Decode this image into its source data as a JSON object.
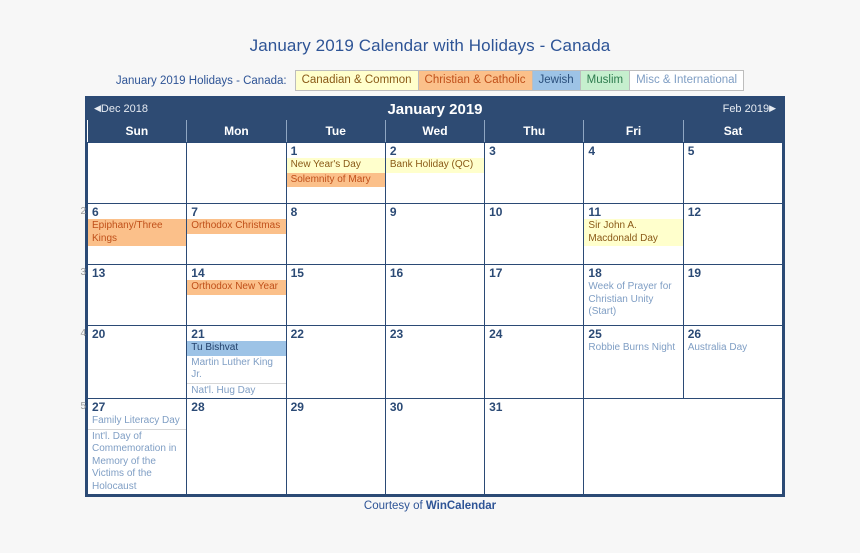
{
  "title": "January 2019 Calendar with Holidays - Canada",
  "legend": {
    "label": "January 2019 Holidays - Canada:",
    "chips": [
      {
        "text": "Canadian & Common",
        "key": "canadian",
        "bg": "#ffffcc",
        "fg": "#8a5a17"
      },
      {
        "text": "Christian & Catholic",
        "key": "christian",
        "bg": "#fbc08a",
        "fg": "#c0501a"
      },
      {
        "text": "Jewish",
        "key": "jewish",
        "bg": "#9dc3e6",
        "fg": "#2a4f7c"
      },
      {
        "text": "Muslim",
        "key": "muslim",
        "bg": "#c6efce",
        "fg": "#2e7d4f"
      },
      {
        "text": "Misc & International",
        "key": "misc",
        "bg": "#ffffff",
        "fg": "#7f9ec4"
      }
    ]
  },
  "nav": {
    "prev": "Dec 2018",
    "prev_arrow": "◀",
    "title": "January 2019",
    "next": "Feb 2019",
    "next_arrow": "▶"
  },
  "weekdays": [
    "Sun",
    "Mon",
    "Tue",
    "Wed",
    "Thu",
    "Fri",
    "Sat"
  ],
  "week_numbers": [
    "",
    "2",
    "3",
    "4",
    "5"
  ],
  "watermark": "WinCalendar",
  "footer": {
    "prefix": "Courtesy of ",
    "brand": "WinCalendar"
  },
  "weeks": [
    {
      "num": "",
      "days": [
        {
          "day": "",
          "blank": true,
          "events": []
        },
        {
          "day": "",
          "blank": true,
          "events": []
        },
        {
          "day": "1",
          "events": [
            {
              "text": "New Year's Day",
              "type": "canadian"
            },
            {
              "text": "Solemnity of Mary",
              "type": "christian"
            }
          ]
        },
        {
          "day": "2",
          "events": [
            {
              "text": "Bank Holiday (QC)",
              "type": "canadian"
            }
          ]
        },
        {
          "day": "3",
          "events": []
        },
        {
          "day": "4",
          "events": []
        },
        {
          "day": "5",
          "weekend": true,
          "events": []
        }
      ]
    },
    {
      "num": "2",
      "days": [
        {
          "day": "6",
          "weekend": true,
          "events": [
            {
              "text": "Epiphany/Three Kings",
              "type": "christian"
            }
          ]
        },
        {
          "day": "7",
          "events": [
            {
              "text": "Orthodox Christmas",
              "type": "christian"
            }
          ]
        },
        {
          "day": "8",
          "events": []
        },
        {
          "day": "9",
          "events": []
        },
        {
          "day": "10",
          "events": []
        },
        {
          "day": "11",
          "events": [
            {
              "text": "Sir John A. Macdonald Day",
              "type": "canadian"
            }
          ]
        },
        {
          "day": "12",
          "weekend": true,
          "events": []
        }
      ]
    },
    {
      "num": "3",
      "days": [
        {
          "day": "13",
          "weekend": true,
          "events": []
        },
        {
          "day": "14",
          "events": [
            {
              "text": "Orthodox New Year",
              "type": "christian"
            }
          ]
        },
        {
          "day": "15",
          "events": []
        },
        {
          "day": "16",
          "events": []
        },
        {
          "day": "17",
          "events": []
        },
        {
          "day": "18",
          "events": [
            {
              "text": "Week of Prayer for Christian Unity (Start)",
              "type": "misc"
            }
          ]
        },
        {
          "day": "19",
          "weekend": true,
          "events": []
        }
      ]
    },
    {
      "num": "4",
      "days": [
        {
          "day": "20",
          "weekend": true,
          "events": []
        },
        {
          "day": "21",
          "events": [
            {
              "text": "Tu Bishvat",
              "type": "jewish"
            },
            {
              "text": "Martin Luther King Jr.",
              "type": "misc"
            },
            {
              "text": "Nat'l. Hug Day",
              "type": "misc"
            }
          ]
        },
        {
          "day": "22",
          "events": []
        },
        {
          "day": "23",
          "events": []
        },
        {
          "day": "24",
          "events": []
        },
        {
          "day": "25",
          "events": [
            {
              "text": "Robbie Burns Night",
              "type": "misc"
            }
          ]
        },
        {
          "day": "26",
          "weekend": true,
          "events": [
            {
              "text": "Australia Day",
              "type": "misc"
            }
          ]
        }
      ]
    },
    {
      "num": "5",
      "days": [
        {
          "day": "27",
          "weekend": true,
          "events": [
            {
              "text": "Family Literacy Day",
              "type": "misc"
            },
            {
              "text": "Int'l. Day of Commemoration in Memory of the Victims of the Holocaust",
              "type": "misc"
            }
          ]
        },
        {
          "day": "28",
          "events": []
        },
        {
          "day": "29",
          "events": []
        },
        {
          "day": "30",
          "events": []
        },
        {
          "day": "31",
          "events": []
        },
        {
          "day": "",
          "blank": true,
          "merged": true,
          "watermark": true,
          "events": []
        }
      ]
    }
  ]
}
